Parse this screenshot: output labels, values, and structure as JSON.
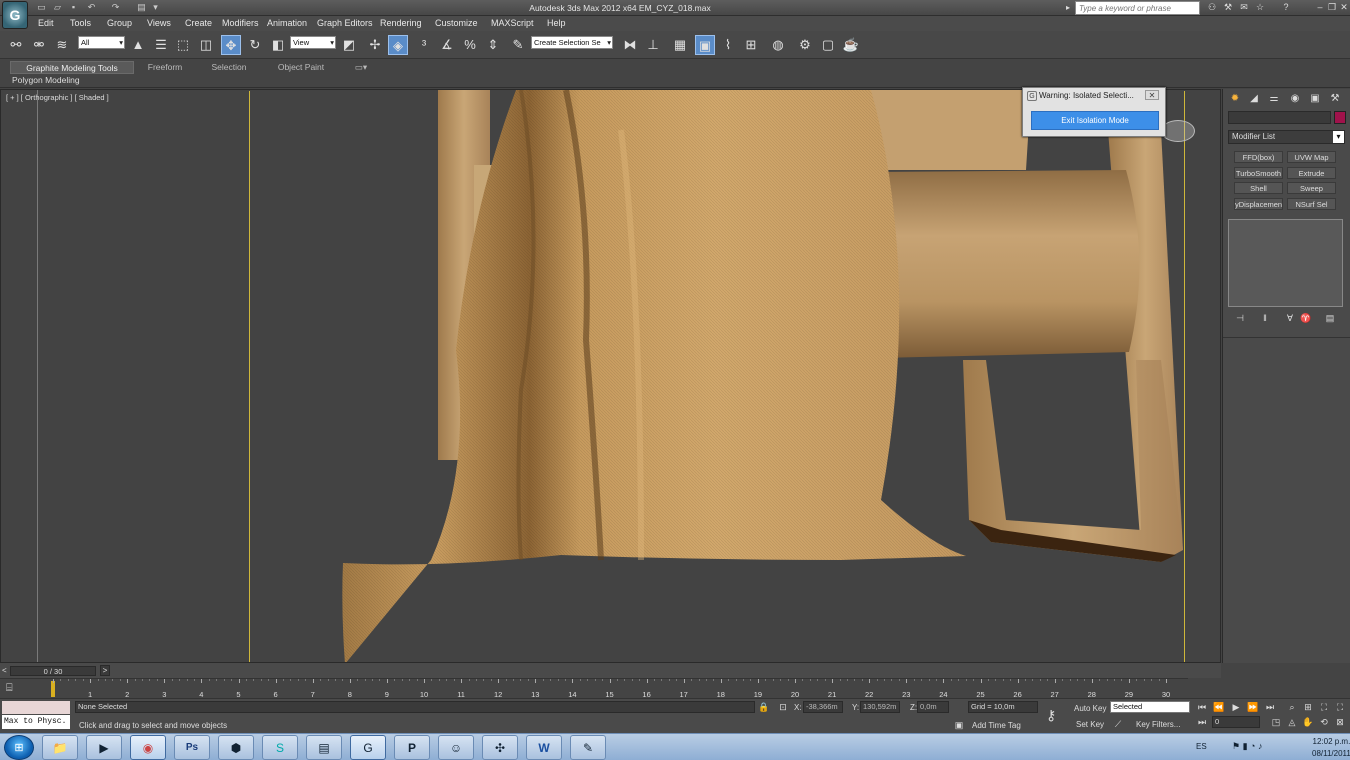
{
  "title": "Autodesk 3ds Max  2012 x64      EM_CYZ_018.max",
  "search_placeholder": "Type a keyword or phrase",
  "menu": [
    "Edit",
    "Tools",
    "Group",
    "Views",
    "Create",
    "Modifiers",
    "Animation",
    "Graph Editors",
    "Rendering",
    "Customize",
    "MAXScript",
    "Help"
  ],
  "toolbar": {
    "selection_filter": "All",
    "ref_coord": "View",
    "named_selection": "Create Selection Se"
  },
  "ribbon": {
    "tabs": [
      "Graphite Modeling Tools",
      "Freeform",
      "Selection",
      "Object Paint"
    ],
    "sub": "Polygon Modeling"
  },
  "viewport": {
    "label": "[ + ] [ Orthographic ] [ Shaded ]"
  },
  "warning": {
    "title": "Warning: Isolated Selecti...",
    "button": "Exit Isolation Mode"
  },
  "command_panel": {
    "modifier_list": "Modifier List",
    "modifiers": [
      "FFD(box)",
      "UVW Map",
      "TurboSmooth",
      "Extrude",
      "Shell",
      "Sweep",
      "yDisplacement",
      "NSurf Sel"
    ]
  },
  "timeline": {
    "slider": "0 / 30",
    "ticks": [
      1,
      2,
      3,
      4,
      5,
      6,
      7,
      8,
      9,
      10,
      11,
      12,
      13,
      14,
      15,
      16,
      17,
      18,
      19,
      20,
      21,
      22,
      23,
      24,
      25,
      26,
      27,
      28,
      29,
      30
    ]
  },
  "status": {
    "maxscript": "Max to Physc.",
    "selection": "None Selected",
    "prompt": "Click and drag to select and move objects",
    "x_label": "X:",
    "x_value": "-38,366m",
    "y_label": "Y:",
    "y_value": "130,592m",
    "z_label": "Z:",
    "z_value": "0,0m",
    "grid": "Grid = 10,0m",
    "add_time_tag": "Add Time Tag",
    "auto_key": "Auto Key",
    "auto_key_sel": "Selected",
    "set_key": "Set Key",
    "key_filters": "Key Filters...",
    "frame": "0"
  },
  "taskbar": {
    "lang": "ES",
    "time": "12:02 p.m.",
    "date": "08/11/2011"
  },
  "colors": {
    "object_color": "#a0124b",
    "active_tool": "#5a8cc8",
    "exit_button": "#3d8fe8"
  }
}
